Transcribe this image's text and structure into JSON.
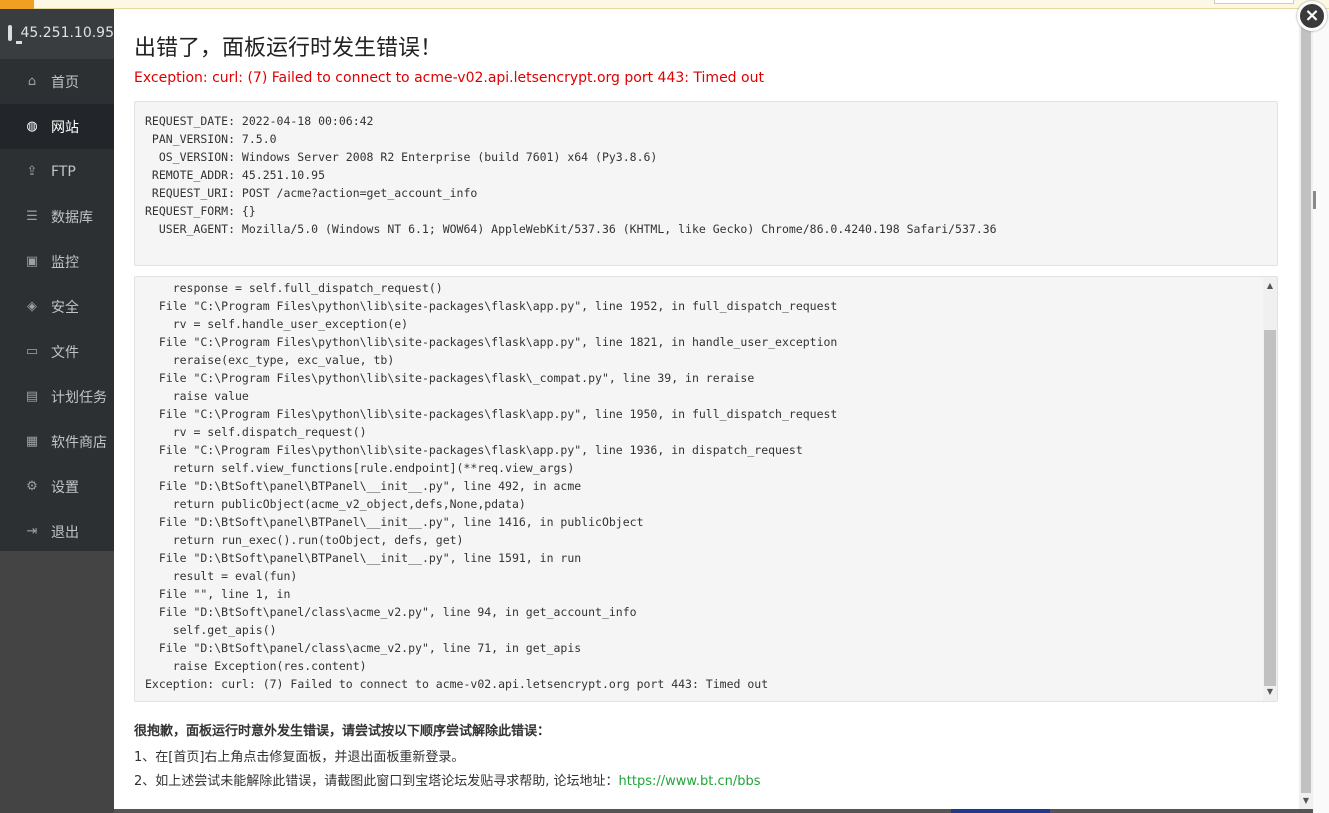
{
  "sidebar": {
    "host": "45.251.10.95",
    "items": [
      {
        "label": "首页",
        "icon": "home-icon",
        "glyph": "⌂"
      },
      {
        "label": "网站",
        "icon": "globe-icon",
        "glyph": "◍",
        "active": true
      },
      {
        "label": "FTP",
        "icon": "upload-icon",
        "glyph": "⇪"
      },
      {
        "label": "数据库",
        "icon": "database-icon",
        "glyph": "☰"
      },
      {
        "label": "监控",
        "icon": "monitor-icon",
        "glyph": "▣"
      },
      {
        "label": "安全",
        "icon": "shield-icon",
        "glyph": "◈"
      },
      {
        "label": "文件",
        "icon": "folder-icon",
        "glyph": "▭"
      },
      {
        "label": "计划任务",
        "icon": "calendar-icon",
        "glyph": "▤"
      },
      {
        "label": "软件商店",
        "icon": "grid-icon",
        "glyph": "▦"
      },
      {
        "label": "设置",
        "icon": "gear-icon",
        "glyph": "⚙"
      },
      {
        "label": "退出",
        "icon": "logout-icon",
        "glyph": "⇥"
      }
    ]
  },
  "dialog": {
    "title": "出错了，面板运行时发生错误！",
    "exception": "Exception: curl: (7) Failed to connect to acme-v02.api.letsencrypt.org port 443: Timed out",
    "close_glyph": "×",
    "env": [
      {
        "key": "REQUEST_DATE",
        "value": "2022-04-18 00:06:42"
      },
      {
        "key": "PAN_VERSION",
        "value": "7.5.0"
      },
      {
        "key": "OS_VERSION",
        "value": "Windows Server 2008 R2 Enterprise (build 7601) x64 (Py3.8.6)"
      },
      {
        "key": "REMOTE_ADDR",
        "value": "45.251.10.95"
      },
      {
        "key": "REQUEST_URI",
        "value": "POST /acme?action=get_account_info"
      },
      {
        "key": "REQUEST_FORM",
        "value": "{}"
      },
      {
        "key": "USER_AGENT",
        "value": "Mozilla/5.0 (Windows NT 6.1; WOW64) AppleWebKit/537.36 (KHTML, like Gecko) Chrome/86.0.4240.198 Safari/537.36"
      }
    ],
    "traceback": [
      "    response = self.full_dispatch_request()",
      "  File \"C:\\Program Files\\python\\lib\\site-packages\\flask\\app.py\", line 1952, in full_dispatch_request",
      "    rv = self.handle_user_exception(e)",
      "  File \"C:\\Program Files\\python\\lib\\site-packages\\flask\\app.py\", line 1821, in handle_user_exception",
      "    reraise(exc_type, exc_value, tb)",
      "  File \"C:\\Program Files\\python\\lib\\site-packages\\flask\\_compat.py\", line 39, in reraise",
      "    raise value",
      "  File \"C:\\Program Files\\python\\lib\\site-packages\\flask\\app.py\", line 1950, in full_dispatch_request",
      "    rv = self.dispatch_request()",
      "  File \"C:\\Program Files\\python\\lib\\site-packages\\flask\\app.py\", line 1936, in dispatch_request",
      "    return self.view_functions[rule.endpoint](**req.view_args)",
      "  File \"D:\\BtSoft\\panel\\BTPanel\\__init__.py\", line 492, in acme",
      "    return publicObject(acme_v2_object,defs,None,pdata)",
      "  File \"D:\\BtSoft\\panel\\BTPanel\\__init__.py\", line 1416, in publicObject",
      "    return run_exec().run(toObject, defs, get)",
      "  File \"D:\\BtSoft\\panel\\BTPanel\\__init__.py\", line 1591, in run",
      "    result = eval(fun)",
      "  File \"\", line 1, in",
      "  File \"D:\\BtSoft\\panel/class\\acme_v2.py\", line 94, in get_account_info",
      "    self.get_apis()",
      "  File \"D:\\BtSoft\\panel/class\\acme_v2.py\", line 71, in get_apis",
      "    raise Exception(res.content)",
      "Exception: curl: (7) Failed to connect to acme-v02.api.letsencrypt.org port 443: Timed out"
    ],
    "help": {
      "title": "很抱歉，面板运行时意外发生错误，请尝试按以下顺序尝试解除此错误：",
      "step1": "1、在[首页]右上角点击修复面板，并退出面板重新登录。",
      "step2_prefix": "2、如上述尝试未能解除此错误，请截图此窗口到宝塔论坛发贴寻求帮助, 论坛地址：",
      "link": "https://www.bt.cn/bbs"
    }
  }
}
